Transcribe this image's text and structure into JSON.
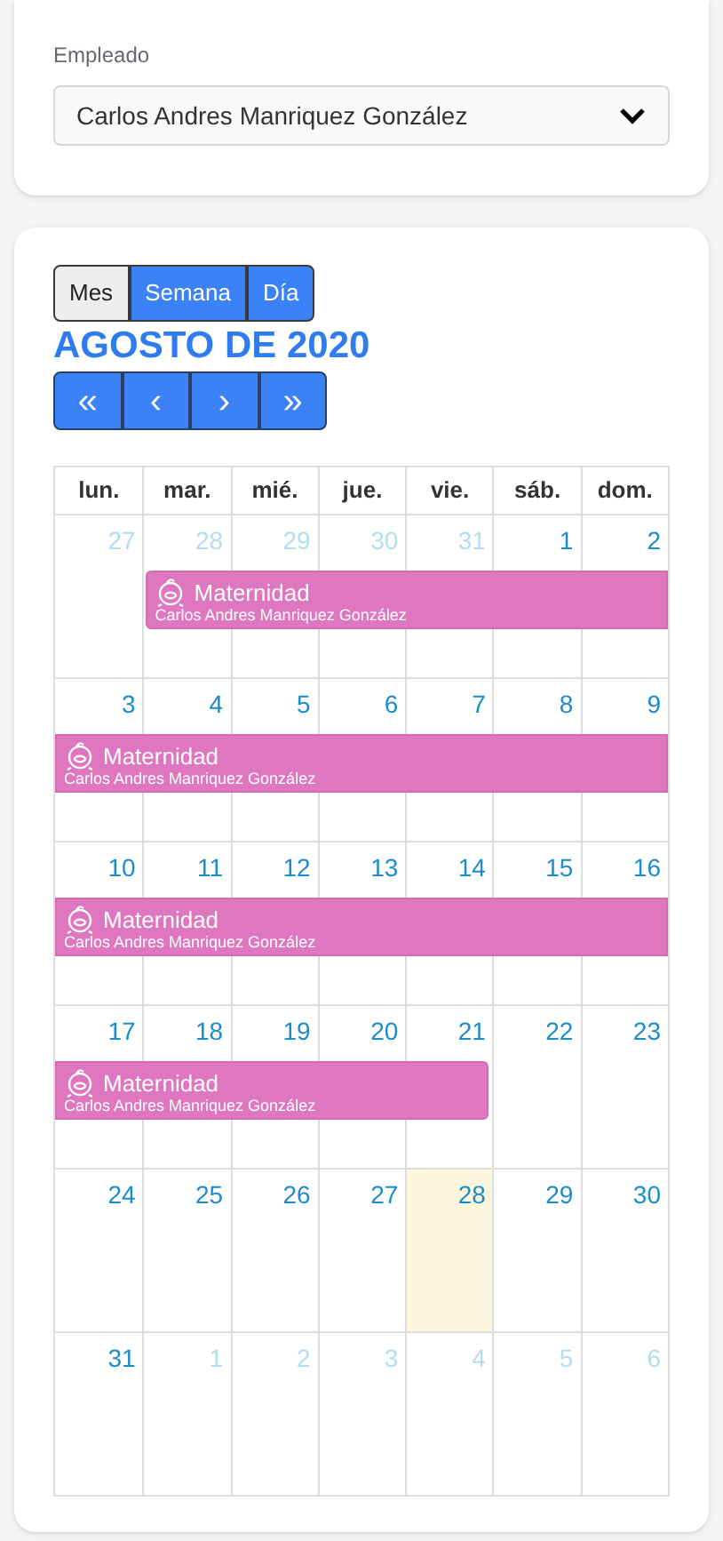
{
  "employee": {
    "label": "Empleado",
    "value": "Carlos Andres Manriquez González"
  },
  "views": [
    {
      "label": "Mes",
      "selected": true
    },
    {
      "label": "Semana",
      "selected": false
    },
    {
      "label": "Día",
      "selected": false
    }
  ],
  "calendar": {
    "title": "AGOSTO DE 2020",
    "nav": [
      {
        "label": "«"
      },
      {
        "label": "‹"
      },
      {
        "label": "›"
      },
      {
        "label": "»"
      }
    ],
    "weekdays": [
      "lun.",
      "mar.",
      "mié.",
      "jue.",
      "vie.",
      "sáb.",
      "dom."
    ],
    "weeks": [
      {
        "days": [
          {
            "label": "27",
            "other_month": true,
            "today": false,
            "in_event": false
          },
          {
            "label": "28",
            "other_month": true,
            "today": false,
            "in_event": true
          },
          {
            "label": "29",
            "other_month": true,
            "today": false,
            "in_event": true
          },
          {
            "label": "30",
            "other_month": true,
            "today": false,
            "in_event": true
          },
          {
            "label": "31",
            "other_month": true,
            "today": false,
            "in_event": true
          },
          {
            "label": "1",
            "other_month": false,
            "today": false,
            "in_event": true
          },
          {
            "label": "2",
            "other_month": false,
            "today": false,
            "in_event": true
          }
        ],
        "event": {
          "title": "Maternidad",
          "person": "Carlos Andres Manriquez González",
          "continues_before": false,
          "continues_after": true
        }
      },
      {
        "days": [
          {
            "label": "3",
            "other_month": false,
            "today": false,
            "in_event": true
          },
          {
            "label": "4",
            "other_month": false,
            "today": false,
            "in_event": true
          },
          {
            "label": "5",
            "other_month": false,
            "today": false,
            "in_event": true
          },
          {
            "label": "6",
            "other_month": false,
            "today": false,
            "in_event": true
          },
          {
            "label": "7",
            "other_month": false,
            "today": false,
            "in_event": true
          },
          {
            "label": "8",
            "other_month": false,
            "today": false,
            "in_event": true
          },
          {
            "label": "9",
            "other_month": false,
            "today": false,
            "in_event": true
          }
        ],
        "event": {
          "title": "Maternidad",
          "person": "Carlos Andres Manriquez González",
          "continues_before": true,
          "continues_after": true
        }
      },
      {
        "days": [
          {
            "label": "10",
            "other_month": false,
            "today": false,
            "in_event": true
          },
          {
            "label": "11",
            "other_month": false,
            "today": false,
            "in_event": true
          },
          {
            "label": "12",
            "other_month": false,
            "today": false,
            "in_event": true
          },
          {
            "label": "13",
            "other_month": false,
            "today": false,
            "in_event": true
          },
          {
            "label": "14",
            "other_month": false,
            "today": false,
            "in_event": true
          },
          {
            "label": "15",
            "other_month": false,
            "today": false,
            "in_event": true
          },
          {
            "label": "16",
            "other_month": false,
            "today": false,
            "in_event": true
          }
        ],
        "event": {
          "title": "Maternidad",
          "person": "Carlos Andres Manriquez González",
          "continues_before": true,
          "continues_after": true
        }
      },
      {
        "days": [
          {
            "label": "17",
            "other_month": false,
            "today": false,
            "in_event": true
          },
          {
            "label": "18",
            "other_month": false,
            "today": false,
            "in_event": true
          },
          {
            "label": "19",
            "other_month": false,
            "today": false,
            "in_event": true
          },
          {
            "label": "20",
            "other_month": false,
            "today": false,
            "in_event": true
          },
          {
            "label": "21",
            "other_month": false,
            "today": false,
            "in_event": true
          },
          {
            "label": "22",
            "other_month": false,
            "today": false,
            "in_event": false
          },
          {
            "label": "23",
            "other_month": false,
            "today": false,
            "in_event": false
          }
        ],
        "event": {
          "title": "Maternidad",
          "person": "Carlos Andres Manriquez González",
          "continues_before": true,
          "continues_after": false
        }
      },
      {
        "days": [
          {
            "label": "24",
            "other_month": false,
            "today": false
          },
          {
            "label": "25",
            "other_month": false,
            "today": false
          },
          {
            "label": "26",
            "other_month": false,
            "today": false
          },
          {
            "label": "27",
            "other_month": false,
            "today": false
          },
          {
            "label": "28",
            "other_month": false,
            "today": true
          },
          {
            "label": "29",
            "other_month": false,
            "today": false
          },
          {
            "label": "30",
            "other_month": false,
            "today": false
          }
        ]
      },
      {
        "days": [
          {
            "label": "31",
            "other_month": false,
            "today": false
          },
          {
            "label": "1",
            "other_month": true,
            "today": false
          },
          {
            "label": "2",
            "other_month": true,
            "today": false
          },
          {
            "label": "3",
            "other_month": true,
            "today": false
          },
          {
            "label": "4",
            "other_month": true,
            "today": false
          },
          {
            "label": "5",
            "other_month": true,
            "today": false
          },
          {
            "label": "6",
            "other_month": true,
            "today": false
          }
        ]
      }
    ]
  }
}
